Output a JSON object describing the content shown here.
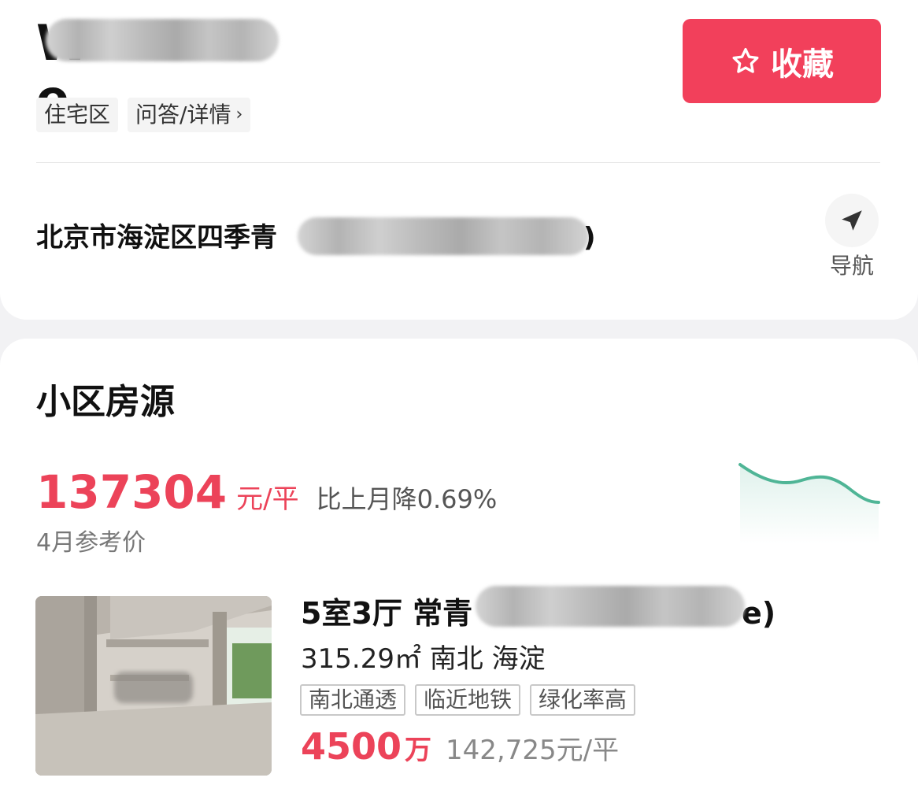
{
  "header": {
    "title_visible_fragment": "W e",
    "fav_label": "收藏",
    "tags": [
      {
        "label": "住宅区"
      },
      {
        "label": "问答/详情"
      }
    ]
  },
  "address": {
    "text": "北京市海淀区四季青",
    "nav_label": "导航"
  },
  "section": {
    "title": "小区房源",
    "price": "137304",
    "price_unit": "元/平",
    "price_change": "比上月降0.69%",
    "ref_label": "4月参考价"
  },
  "listing": {
    "title_prefix": "5室3厅 常青",
    "title_suffix": "e)",
    "area_dir_district": "315.29㎡ 南北 海淀",
    "tags": [
      {
        "label": "南北通透"
      },
      {
        "label": "临近地铁"
      },
      {
        "label": "绿化率高"
      }
    ],
    "total_price": "4500",
    "total_unit": "万",
    "unit_price": "142,725元/平"
  },
  "colors": {
    "accent": "#f2405b",
    "price_red": "#ec4359",
    "trend_green": "#4fb596"
  }
}
